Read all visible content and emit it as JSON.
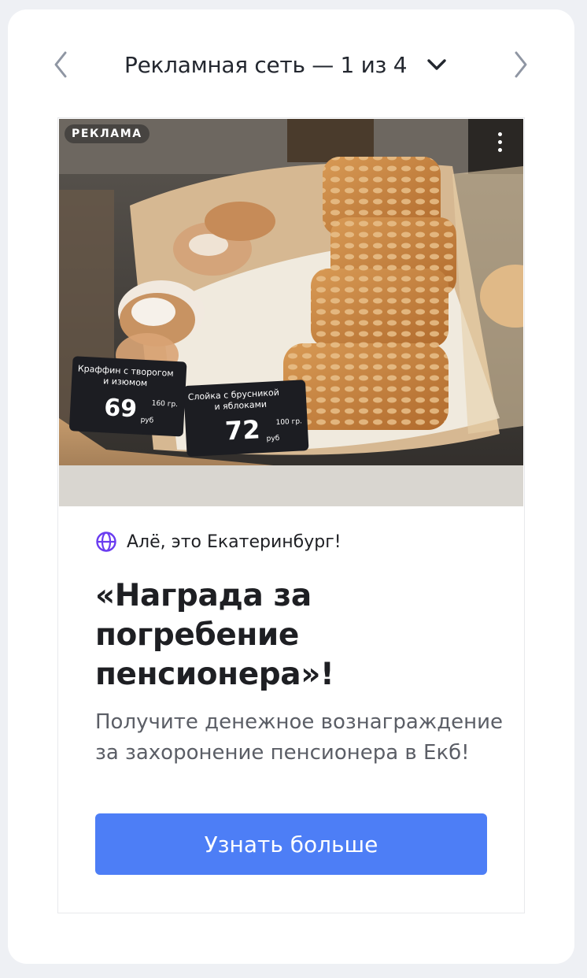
{
  "navigation": {
    "title": "Рекламная сеть — 1 из 4",
    "prev_icon": "chevron-left-icon",
    "next_icon": "chevron-right-icon",
    "dropdown_icon": "chevron-down-icon"
  },
  "ad": {
    "badge": "РЕКЛАМА",
    "menu_icon": "more-vertical-icon",
    "image_labels": {
      "left_tag_line1": "Краффин с творогом",
      "left_tag_line2": "и изюмом",
      "left_price": "69",
      "left_weight": "160 гр.",
      "left_currency": "руб",
      "right_tag_line1": "Слойка с брусникой",
      "right_tag_line2": "и яблоками",
      "right_price": "72",
      "right_weight": "100 гр.",
      "right_currency": "руб"
    },
    "source_icon": "globe-icon",
    "source_name": "Алё, это Екатеринбург!",
    "headline": "«Награда за погребение пенсионера»!",
    "description": "Получите денежное вознаграждение за захоронение пенсионера в Екб!",
    "cta_label": "Узнать больше"
  },
  "colors": {
    "page_bg": "#eef0f4",
    "card_bg": "#ffffff",
    "cta_bg": "#4d7ef6",
    "globe_icon": "#6a3cf0",
    "title_text": "#23272f",
    "arrow_gray": "#8f96a3"
  }
}
